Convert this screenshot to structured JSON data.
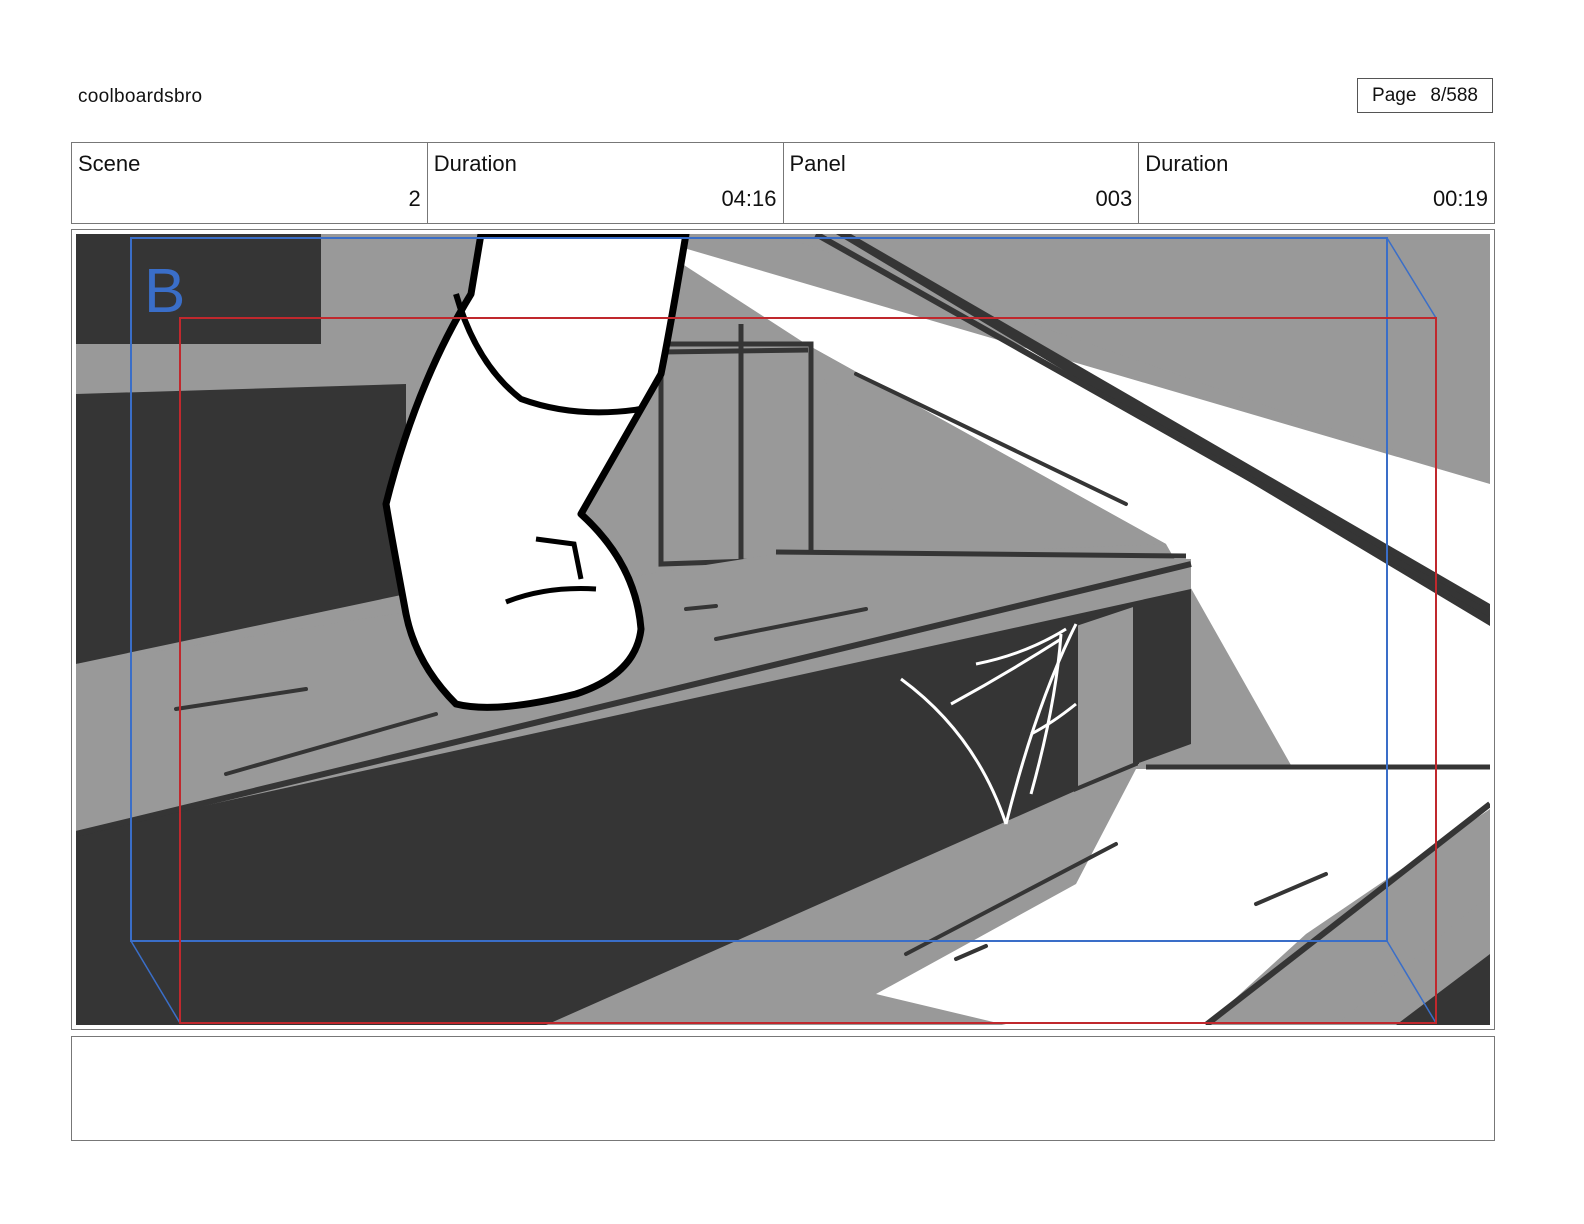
{
  "header": {
    "project_name": "coolboardsbro",
    "page_label": "Page",
    "page_value": "8/588"
  },
  "info": {
    "scene_label": "Scene",
    "scene_value": "2",
    "scene_duration_label": "Duration",
    "scene_duration_value": "04:16",
    "panel_label": "Panel",
    "panel_value": "003",
    "panel_duration_label": "Duration",
    "panel_duration_value": "00:19"
  },
  "panel": {
    "camera_key_label": "B",
    "colors": {
      "dark": "#353535",
      "mid": "#999999",
      "light": "#ffffff",
      "camera_start": "#3a6ec8",
      "camera_end": "#c0282d"
    }
  },
  "notes": {
    "text": ""
  }
}
